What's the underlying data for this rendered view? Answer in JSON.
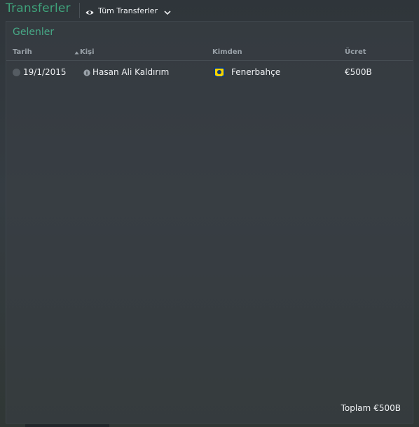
{
  "header": {
    "title": "Transferler",
    "filter": {
      "label": "Tüm Transferler",
      "icon": "eye-icon",
      "dropdown_icon": "chevron-down-icon"
    }
  },
  "section": {
    "title": "Gelenler"
  },
  "table": {
    "columns": {
      "date": "Tarih",
      "person": "Kişi",
      "from": "Kimden",
      "fee": "Ücret"
    },
    "sorted_column": "person",
    "rows": [
      {
        "date": "19/1/2015",
        "person": "Hasan Ali Kaldırım",
        "from": "Fenerbahçe",
        "from_badge_colors": [
          "#f5d400",
          "#123a7a"
        ],
        "fee": "€500B"
      }
    ]
  },
  "summary": {
    "label": "Toplam",
    "value": "€500B"
  },
  "colors": {
    "accent": "#3fa37b",
    "section_title": "#47a886",
    "text": "#eef0f2",
    "header_text": "#9aa2a9"
  }
}
